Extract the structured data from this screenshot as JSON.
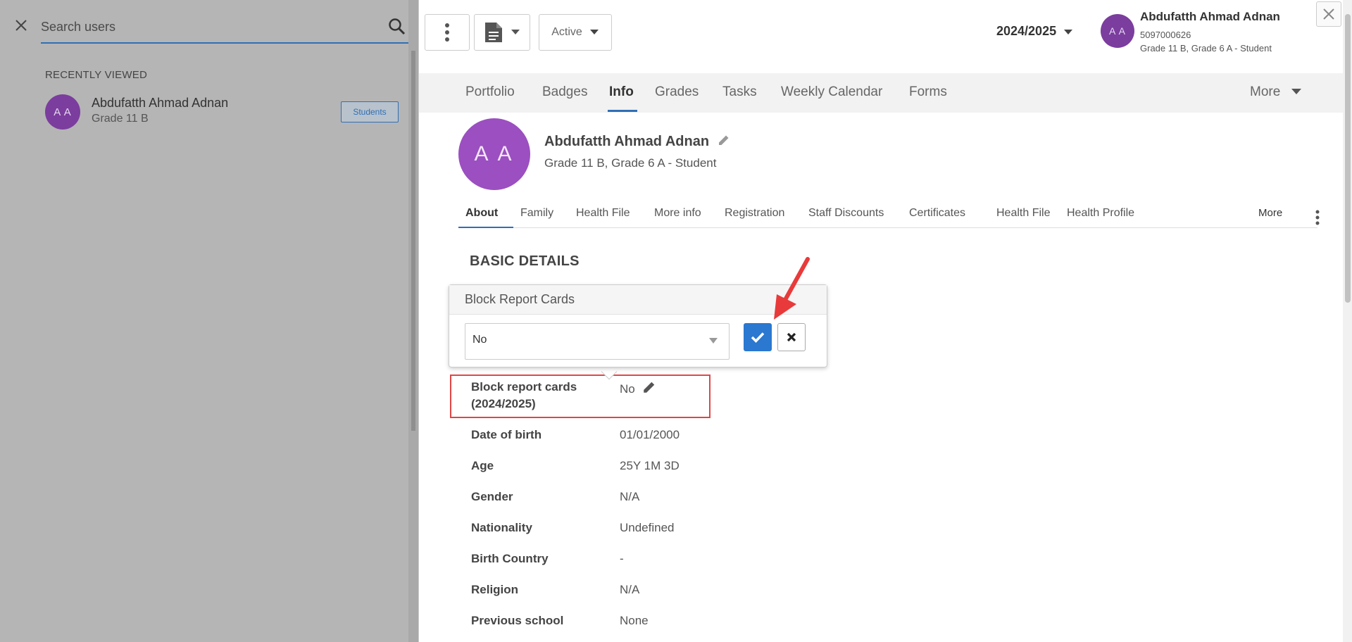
{
  "left_panel": {
    "search_placeholder": "Search users",
    "recent_title": "RECENTLY VIEWED",
    "recent_items": [
      {
        "initials": "A A",
        "name": "Abdufatth Ahmad Adnan",
        "sub": "Grade 11 B",
        "badge": "Students"
      }
    ]
  },
  "topbar": {
    "status_label": "Active",
    "year": "2024/2025",
    "user_initials": "A A",
    "user_name": "Abdufatth Ahmad Adnan",
    "user_id": "5097000626",
    "user_grade": "Grade 11 B, Grade 6 A - Student"
  },
  "nav": {
    "items": [
      "Portfolio",
      "Badges",
      "Info",
      "Grades",
      "Tasks",
      "Weekly Calendar",
      "Forms"
    ],
    "active": "Info",
    "more_label": "More"
  },
  "profile": {
    "initials": "A A",
    "name": "Abdufatth Ahmad Adnan",
    "sub": "Grade 11 B, Grade 6 A - Student"
  },
  "subtabs": {
    "items": [
      "About",
      "Family",
      "Health File",
      "More info",
      "Registration",
      "Staff Discounts",
      "Certificates",
      "Health File",
      "Health Profile"
    ],
    "active": "About",
    "more_label": "More"
  },
  "section": {
    "title": "BASIC DETAILS"
  },
  "popover": {
    "title": "Block Report Cards",
    "selected": "No"
  },
  "fields": [
    {
      "label": "Block report cards",
      "label2": "(2024/2025)",
      "value": "No"
    },
    {
      "label": "Date of birth",
      "value": "01/01/2000"
    },
    {
      "label": "Age",
      "value": "25Y 1M 3D"
    },
    {
      "label": "Gender",
      "value": "N/A"
    },
    {
      "label": "Nationality",
      "value": "Undefined"
    },
    {
      "label": "Birth Country",
      "value": "-"
    },
    {
      "label": "Religion",
      "value": "N/A"
    },
    {
      "label": "Previous school",
      "value": "None"
    }
  ],
  "colors": {
    "accent": "#2f6fb5",
    "avatar": "#9b4fc0",
    "highlight": "#e04646",
    "arrow": "#e83a3a",
    "ok_button": "#2a78d0"
  }
}
